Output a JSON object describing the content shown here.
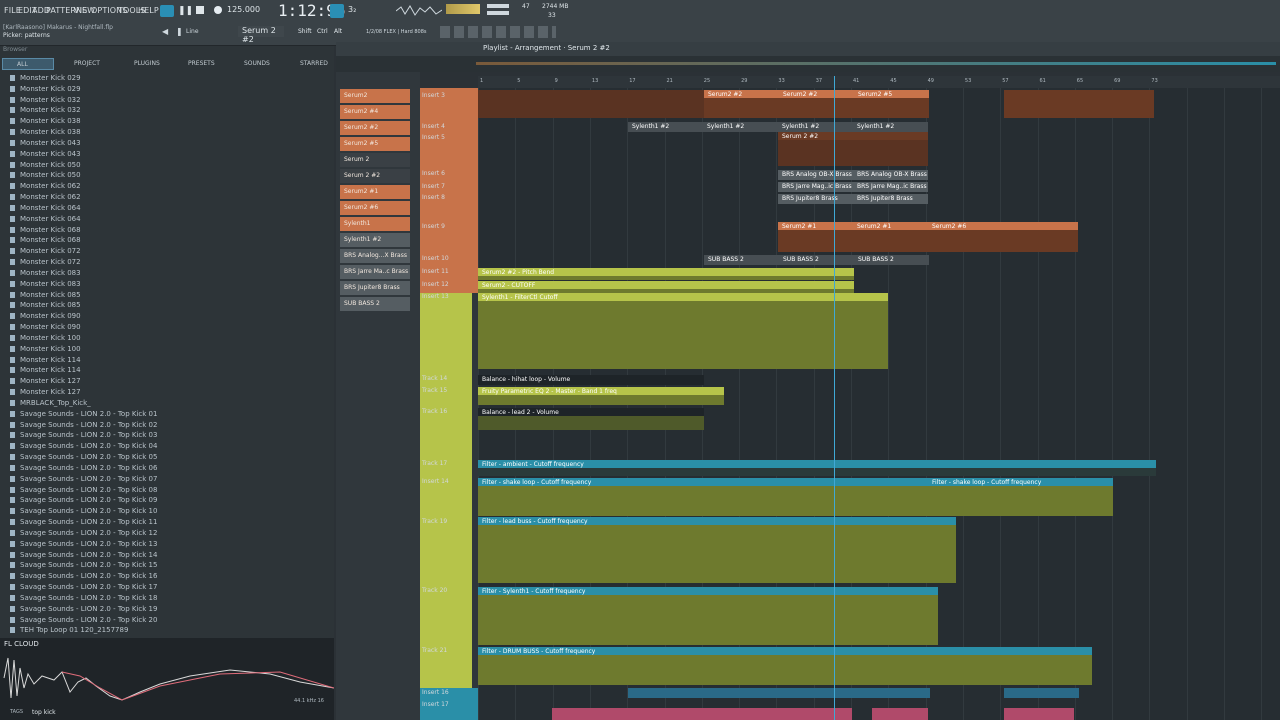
{
  "menu": [
    "FILE",
    "EDIT",
    "ADD",
    "PATTERNS",
    "VIEW",
    "OPTIONS",
    "TOOLS",
    "HELP"
  ],
  "transport": {
    "tempo": "125.000",
    "time": "1:12:96",
    "pattern": "Serum 2 #2",
    "mode": "Line"
  },
  "project": {
    "title": "[KarlRaasono] Makarus - Nightfall.flp",
    "hint": "Picker: patterns"
  },
  "stats": {
    "cpu": "47",
    "memory": "2744 MB",
    "voices": "33"
  },
  "snap": "1/2/08 FLEX | Hard 808s",
  "playlist_title": "Playlist - Arrangement · Serum 2 #2",
  "browser": {
    "label": "Browser",
    "tabs": [
      "ALL",
      "PROJECT",
      "PLUGINS",
      "PRESETS",
      "SOUNDS",
      "STARRED"
    ],
    "items": [
      "Monster Kick 029",
      "Monster Kick 029",
      "Monster Kick 032",
      "Monster Kick 032",
      "Monster Kick 038",
      "Monster Kick 038",
      "Monster Kick 043",
      "Monster Kick 043",
      "Monster Kick 050",
      "Monster Kick 050",
      "Monster Kick 062",
      "Monster Kick 062",
      "Monster Kick 064",
      "Monster Kick 064",
      "Monster Kick 068",
      "Monster Kick 068",
      "Monster Kick 072",
      "Monster Kick 072",
      "Monster Kick 083",
      "Monster Kick 083",
      "Monster Kick 085",
      "Monster Kick 085",
      "Monster Kick 090",
      "Monster Kick 090",
      "Monster Kick 100",
      "Monster Kick 100",
      "Monster Kick 114",
      "Monster Kick 114",
      "Monster Kick 127",
      "Monster Kick 127",
      "MRBLACK_Top_Kick_",
      "Savage Sounds - LION 2.0 - Top Kick 01",
      "Savage Sounds - LION 2.0 - Top Kick 02",
      "Savage Sounds - LION 2.0 - Top Kick 03",
      "Savage Sounds - LION 2.0 - Top Kick 04",
      "Savage Sounds - LION 2.0 - Top Kick 05",
      "Savage Sounds - LION 2.0 - Top Kick 06",
      "Savage Sounds - LION 2.0 - Top Kick 07",
      "Savage Sounds - LION 2.0 - Top Kick 08",
      "Savage Sounds - LION 2.0 - Top Kick 09",
      "Savage Sounds - LION 2.0 - Top Kick 10",
      "Savage Sounds - LION 2.0 - Top Kick 11",
      "Savage Sounds - LION 2.0 - Top Kick 12",
      "Savage Sounds - LION 2.0 - Top Kick 13",
      "Savage Sounds - LION 2.0 - Top Kick 14",
      "Savage Sounds - LION 2.0 - Top Kick 15",
      "Savage Sounds - LION 2.0 - Top Kick 16",
      "Savage Sounds - LION 2.0 - Top Kick 17",
      "Savage Sounds - LION 2.0 - Top Kick 18",
      "Savage Sounds - LION 2.0 - Top Kick 19",
      "Savage Sounds - LION 2.0 - Top Kick 20",
      "TEH Top Loop 01 120_2157789"
    ]
  },
  "cloud": {
    "title": "FL CLOUD",
    "samplerate": "44.1 kHz 16",
    "tags": "TAGS",
    "tag": "top kick"
  },
  "channels": [
    "Serum2",
    "Serum2 #4",
    "Serum2 #2",
    "Serum2 #5",
    "Serum 2",
    "Serum 2 #2",
    "Serum2 #1",
    "Serum2 #6",
    "Sylenth1",
    "Sylenth1 #2",
    "BRS Analog...X Brass",
    "BRS Jarre Ma..c Brass",
    "BRS Jupiter8 Brass",
    "SUB BASS 2"
  ],
  "tracks": [
    [
      "Insert 3",
      4
    ],
    [
      "Insert 4",
      35
    ],
    [
      "Insert 5",
      46
    ],
    [
      "Insert 6",
      82
    ],
    [
      "Insert 7",
      95
    ],
    [
      "Insert 8",
      106
    ],
    [
      "Insert 9",
      135
    ],
    [
      "Insert 10",
      167
    ],
    [
      "Insert 11",
      180
    ],
    [
      "Insert 12",
      193
    ],
    [
      "Insert 13",
      205
    ],
    [
      "Track 14",
      287
    ],
    [
      "Track 15",
      299
    ],
    [
      "Track 16",
      320
    ],
    [
      "Track 17",
      372
    ],
    [
      "Insert 14",
      390
    ],
    [
      "Track 19",
      430
    ],
    [
      "Track 20",
      499
    ],
    [
      "Track 21",
      559
    ],
    [
      "Insert 16",
      601
    ],
    [
      "Insert 17",
      613
    ]
  ],
  "ruler": [
    "1",
    "5",
    "9",
    "13",
    "17",
    "21",
    "25",
    "29",
    "33",
    "37",
    "41",
    "45",
    "49",
    "53",
    "57",
    "61",
    "65",
    "69",
    "73"
  ],
  "clips": {
    "serum": [
      "Serum2 #2",
      "Serum2 #2",
      "Serum2 #5"
    ],
    "sylenth": [
      "Sylenth1 #2",
      "Sylenth1 #2",
      "Sylenth1 #2",
      "Sylenth1 #2"
    ],
    "serum2": "Serum 2 #2",
    "brs": [
      "BRS Analog OB-X Brass",
      "BRS Analog OB-X Brass",
      "BRS Jarre Mag..ic Brass",
      "BRS Jarre Mag..ic Brass",
      "BRS Jupiter8 Brass",
      "BRS Jupiter8 Brass"
    ],
    "serum9": [
      "Serum2 #1",
      "Serum2 #1",
      "Serum2 #6"
    ],
    "sub": [
      "SUB BASS 2",
      "SUB BASS 2",
      "SUB BASS 2"
    ],
    "auto": [
      "Serum2 #2 - Pitch Bend",
      "Serum2 - CUTOFF",
      "Sylenth1 - FilterCtl Cutoff",
      "Balance - hihat loop - Volume",
      "Fruity Parametric EQ 2 - Master - Band 1 freq",
      "Balance - lead 2 - Volume",
      "Filter - ambient - Cutoff frequency",
      "Filter - shake loop - Cutoff frequency",
      "Filter - shake loop - Cutoff frequency",
      "Filter - lead buss - Cutoff frequency",
      "Filter - Sylenth1 - Cutoff frequency",
      "Filter - DRUM BUSS - Cutoff frequency"
    ]
  },
  "colors": {
    "orange": "#c8734a",
    "olive": "#6e7a2e",
    "lime": "#b6c44a",
    "teal": "#2a8fa8",
    "playhead": "#3fa9d6"
  }
}
